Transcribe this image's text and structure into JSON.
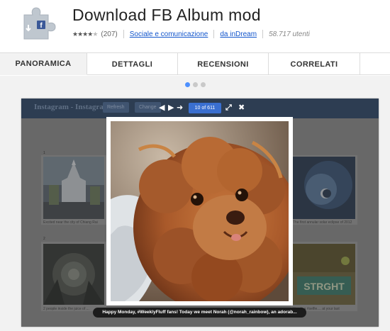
{
  "extension": {
    "title": "Download FB Album mod",
    "rating_stars": 4,
    "rating_count": "(207)",
    "category": "Sociale e comunicazione",
    "author": "da inDream",
    "users": "58.717 utenti",
    "icon": "puzzle-piece-icon"
  },
  "tabs": [
    {
      "label": "PANORAMICA",
      "active": true
    },
    {
      "label": "DETTAGLI",
      "active": false
    },
    {
      "label": "RECENSIONI",
      "active": false
    },
    {
      "label": "CORRELATI",
      "active": false
    }
  ],
  "carousel": {
    "slide_count": 3,
    "active_index": 0
  },
  "screenshot": {
    "app_title": "Instagram - Instagram",
    "btn_refresh": "Refresh",
    "btn_change": "Change",
    "counter": "10 of 611",
    "caption": "Happy Monday, #WeeklyFluff fans! Today we meet Norah (@norah_rainbow), an adorab...",
    "bg_numbers": [
      "1",
      "2"
    ],
    "bg_captions": [
      "Excited near the city of Chiang Rai",
      "2 people inside the juice of ...",
      "The first annular solar eclipse of 2012",
      "Here's a #selfie.... at your last"
    ]
  },
  "colors": {
    "accent_blue": "#4d90fe",
    "link_blue": "#1155cc",
    "counter_blue": "#3a6fd0",
    "app_bar": "#2d3d52",
    "puppy_fur": "#b4652e"
  }
}
